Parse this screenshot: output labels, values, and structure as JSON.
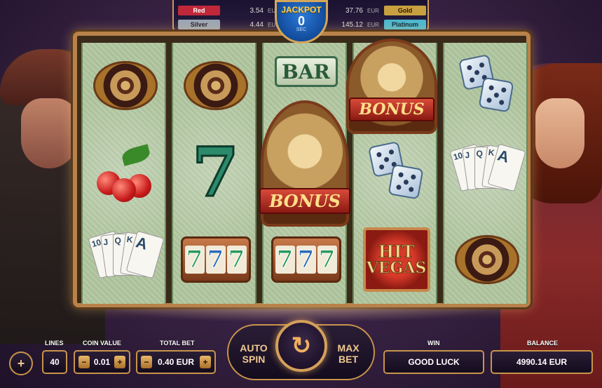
{
  "jackpot": {
    "title": "JACKPOT",
    "seconds": "0",
    "unit": "SEC",
    "tiers": [
      {
        "name": "Red",
        "value": "3.54",
        "currency": "EUR",
        "color": "#c0283a"
      },
      {
        "name": "Silver",
        "value": "4.44",
        "currency": "EUR",
        "color": "#9aa6b4"
      },
      {
        "name": "Gold",
        "value": "37.76",
        "currency": "EUR",
        "color": "#c8a040"
      },
      {
        "name": "Platinum",
        "value": "145.12",
        "currency": "EUR",
        "color": "#4ab8d0"
      }
    ]
  },
  "reels": [
    [
      "roulette",
      "cherry",
      "cards"
    ],
    [
      "roulette",
      "seven",
      "triple7"
    ],
    [
      "bar",
      "bonus",
      "triple7"
    ],
    [
      "bonus",
      "dice",
      "hitvegas"
    ],
    [
      "dice",
      "cards",
      "roulette"
    ]
  ],
  "symbols": {
    "bar_text": "BAR",
    "bonus_text": "BONUS",
    "hit_text": "HIT",
    "vegas_text": "VEGAS",
    "seven_text": "7",
    "cards_ranks": [
      "10",
      "J",
      "Q",
      "K",
      "A"
    ]
  },
  "controls": {
    "menu_label": "+",
    "lines_label": "LINES",
    "lines_value": "40",
    "coin_value_label": "COIN VALUE",
    "coin_value": "0.01",
    "total_bet_label": "TOTAL BET",
    "total_bet_value": "0.40 EUR",
    "minus": "−",
    "plus": "+",
    "auto_spin_label": "AUTO SPIN",
    "max_bet_label": "MAX BET",
    "spin_icon": "↻",
    "win_label": "WIN",
    "win_value": "GOOD LUCK",
    "balance_label": "BALANCE",
    "balance_value": "4990.14 EUR"
  },
  "colors": {
    "accent_gold": "#c8944a",
    "panel_bg": "#1e142a"
  }
}
